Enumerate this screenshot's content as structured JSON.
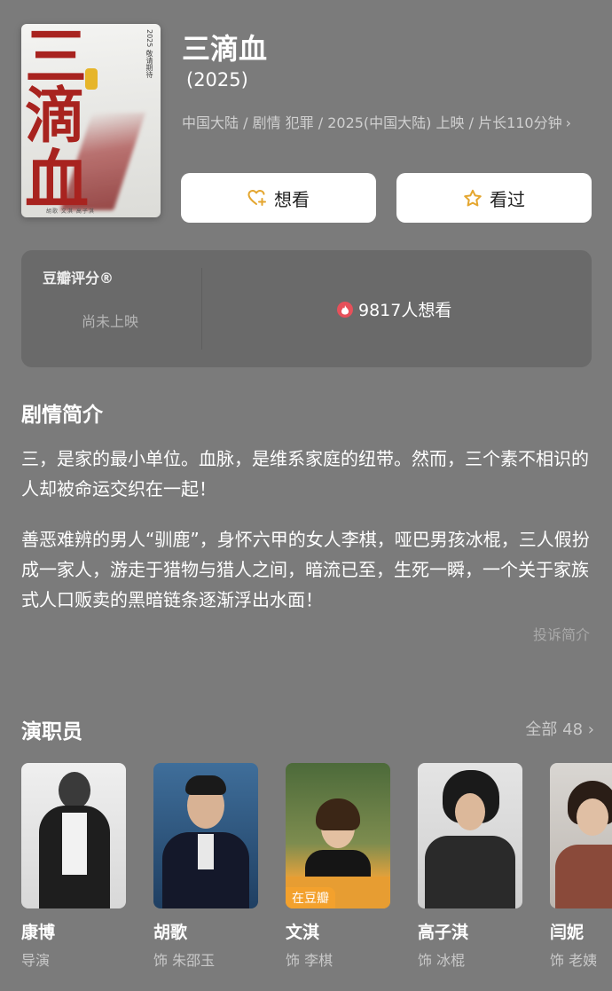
{
  "movie": {
    "title": "三滴血",
    "year": "(2025)",
    "meta": "中国大陆 / 剧情 犯罪 / 2025(中国大陆) 上映 / 片长110分钟",
    "meta_chevron": "›",
    "poster": {
      "chars": [
        "三",
        "滴",
        "血"
      ],
      "side_text": "2025 敬请期待",
      "credits": "胡歌 文淇 高子淇"
    }
  },
  "actions": {
    "want_label": "想看",
    "seen_label": "看过",
    "want_icon": "heart-plus-icon",
    "seen_icon": "star-icon",
    "icon_color": "#e4a62f"
  },
  "rating": {
    "label": "豆瓣评分®",
    "status": "尚未上映",
    "wish_count_text": "9817人想看",
    "wish_icon": "flame-icon"
  },
  "synopsis": {
    "title": "剧情简介",
    "paragraphs": [
      "三，是家的最小单位。血脉，是维系家庭的纽带。然而，三个素不相识的人却被命运交织在一起！",
      "善恶难辨的男人“驯鹿”，身怀六甲的女人李棋，哑巴男孩冰棍，三人假扮成一家人，游走于猎物与猎人之间，暗流已至，生死一瞬，一个关于家族式人口贩卖的黑暗链条逐渐浮出水面！"
    ],
    "report_link": "投诉简介"
  },
  "cast": {
    "title": "演职员",
    "all_label": "全部 48",
    "members": [
      {
        "name": "康博",
        "role": "导演",
        "badge": ""
      },
      {
        "name": "胡歌",
        "role": "饰 朱邵玉",
        "badge": ""
      },
      {
        "name": "文淇",
        "role": "饰 李棋",
        "badge": "在豆瓣"
      },
      {
        "name": "高子淇",
        "role": "饰 冰棍",
        "badge": ""
      },
      {
        "name": "闫妮",
        "role": "饰 老姨",
        "badge": ""
      }
    ]
  }
}
